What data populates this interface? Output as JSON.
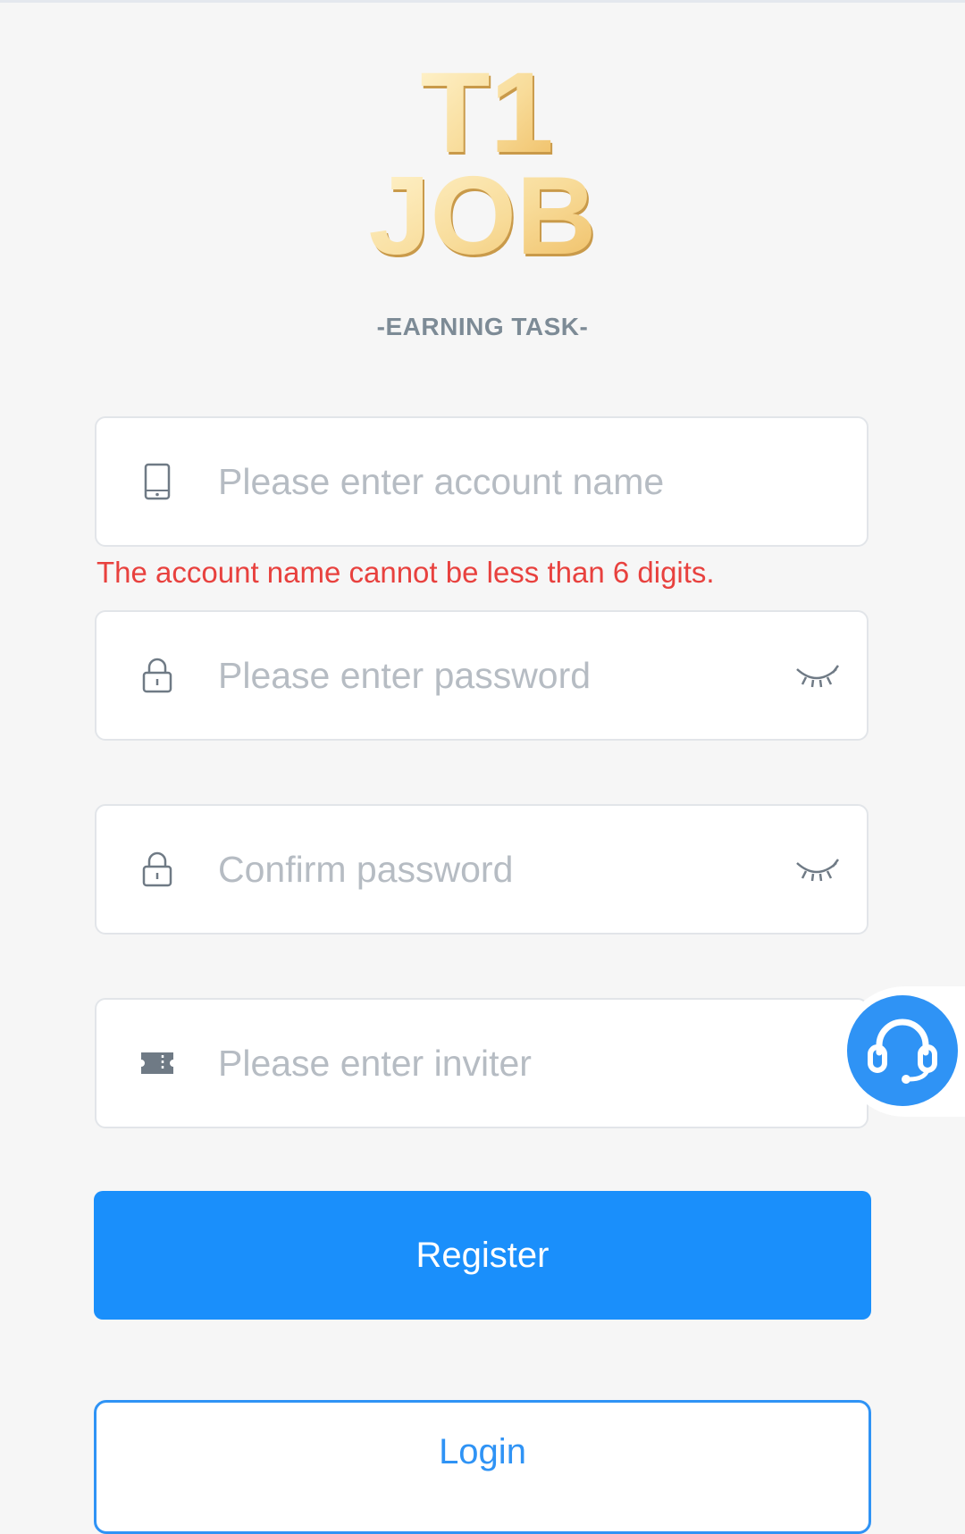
{
  "logo": {
    "line1": "T1",
    "line2": "JOB"
  },
  "subtitle": "-EARNING TASK-",
  "form": {
    "account": {
      "placeholder": "Please enter account name",
      "icon": "phone-icon"
    },
    "error": "The account name cannot be less than 6 digits.",
    "password": {
      "placeholder": "Please enter password",
      "icon": "lock-icon",
      "toggle_icon": "eye-closed-icon"
    },
    "confirm": {
      "placeholder": "Confirm password",
      "icon": "lock-icon",
      "toggle_icon": "eye-closed-icon"
    },
    "inviter": {
      "placeholder": "Please enter inviter",
      "icon": "ticket-icon"
    }
  },
  "buttons": {
    "register": "Register",
    "login": "Login"
  },
  "support": {
    "icon": "headset-icon"
  },
  "colors": {
    "primary": "#1a8ffb",
    "error": "#e8413e",
    "logo_gold_light": "#fdf0c4",
    "logo_gold_dark": "#f0c46e"
  }
}
